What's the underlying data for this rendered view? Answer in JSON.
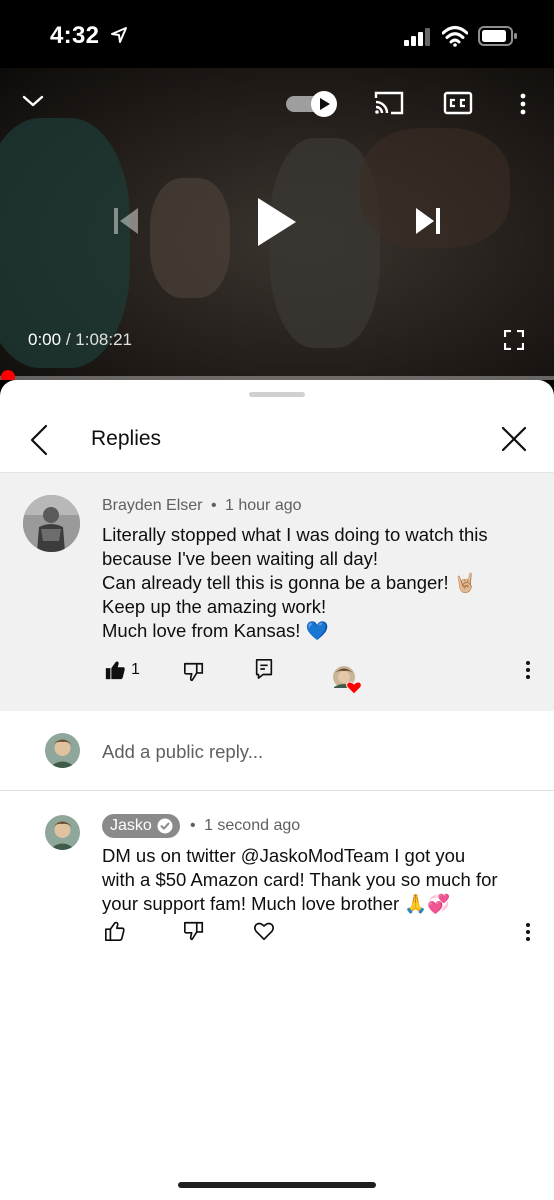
{
  "status_bar": {
    "time": "4:32",
    "icons": [
      "location-arrow-icon",
      "signal-icon",
      "wifi-icon",
      "battery-icon"
    ]
  },
  "player": {
    "current_time": "0:00",
    "separator": " / ",
    "duration": "1:08:21",
    "progress": 0,
    "autoplay_on": true,
    "icons": [
      "minimize-icon",
      "autoplay-toggle",
      "cast-icon",
      "cc-icon",
      "more-icon",
      "previous-icon",
      "play-icon",
      "next-icon",
      "fullscreen-icon"
    ]
  },
  "replies_panel": {
    "title": "Replies",
    "back_icon": "chevron-left-icon",
    "close_icon": "close-icon"
  },
  "parent_comment": {
    "author": "Brayden Elser",
    "dot": "•",
    "time": "1 hour ago",
    "text": "Literally stopped what I was doing to watch this\nbecause I've been waiting all day!\nCan already tell this is gonna be a banger! 🤘🏼\nKeep up the amazing work!\nMuch love from Kansas! 💙",
    "like_count": "1",
    "liked": true,
    "hearted_by_creator": true
  },
  "reply_input": {
    "placeholder": "Add a public reply..."
  },
  "reply": {
    "author": "Jasko",
    "verified": true,
    "dot": "•",
    "time": "1 second ago",
    "text": "DM us on twitter @JaskoModTeam I got you\nwith a $50 Amazon card! Thank you so much for\nyour support fam! Much love brother 🙏💞"
  },
  "colors": {
    "accent_red": "#ff0000",
    "highlight_bg": "#f1f1f1",
    "secondary_text": "#606060",
    "author_chip": "#8a8a8a"
  }
}
